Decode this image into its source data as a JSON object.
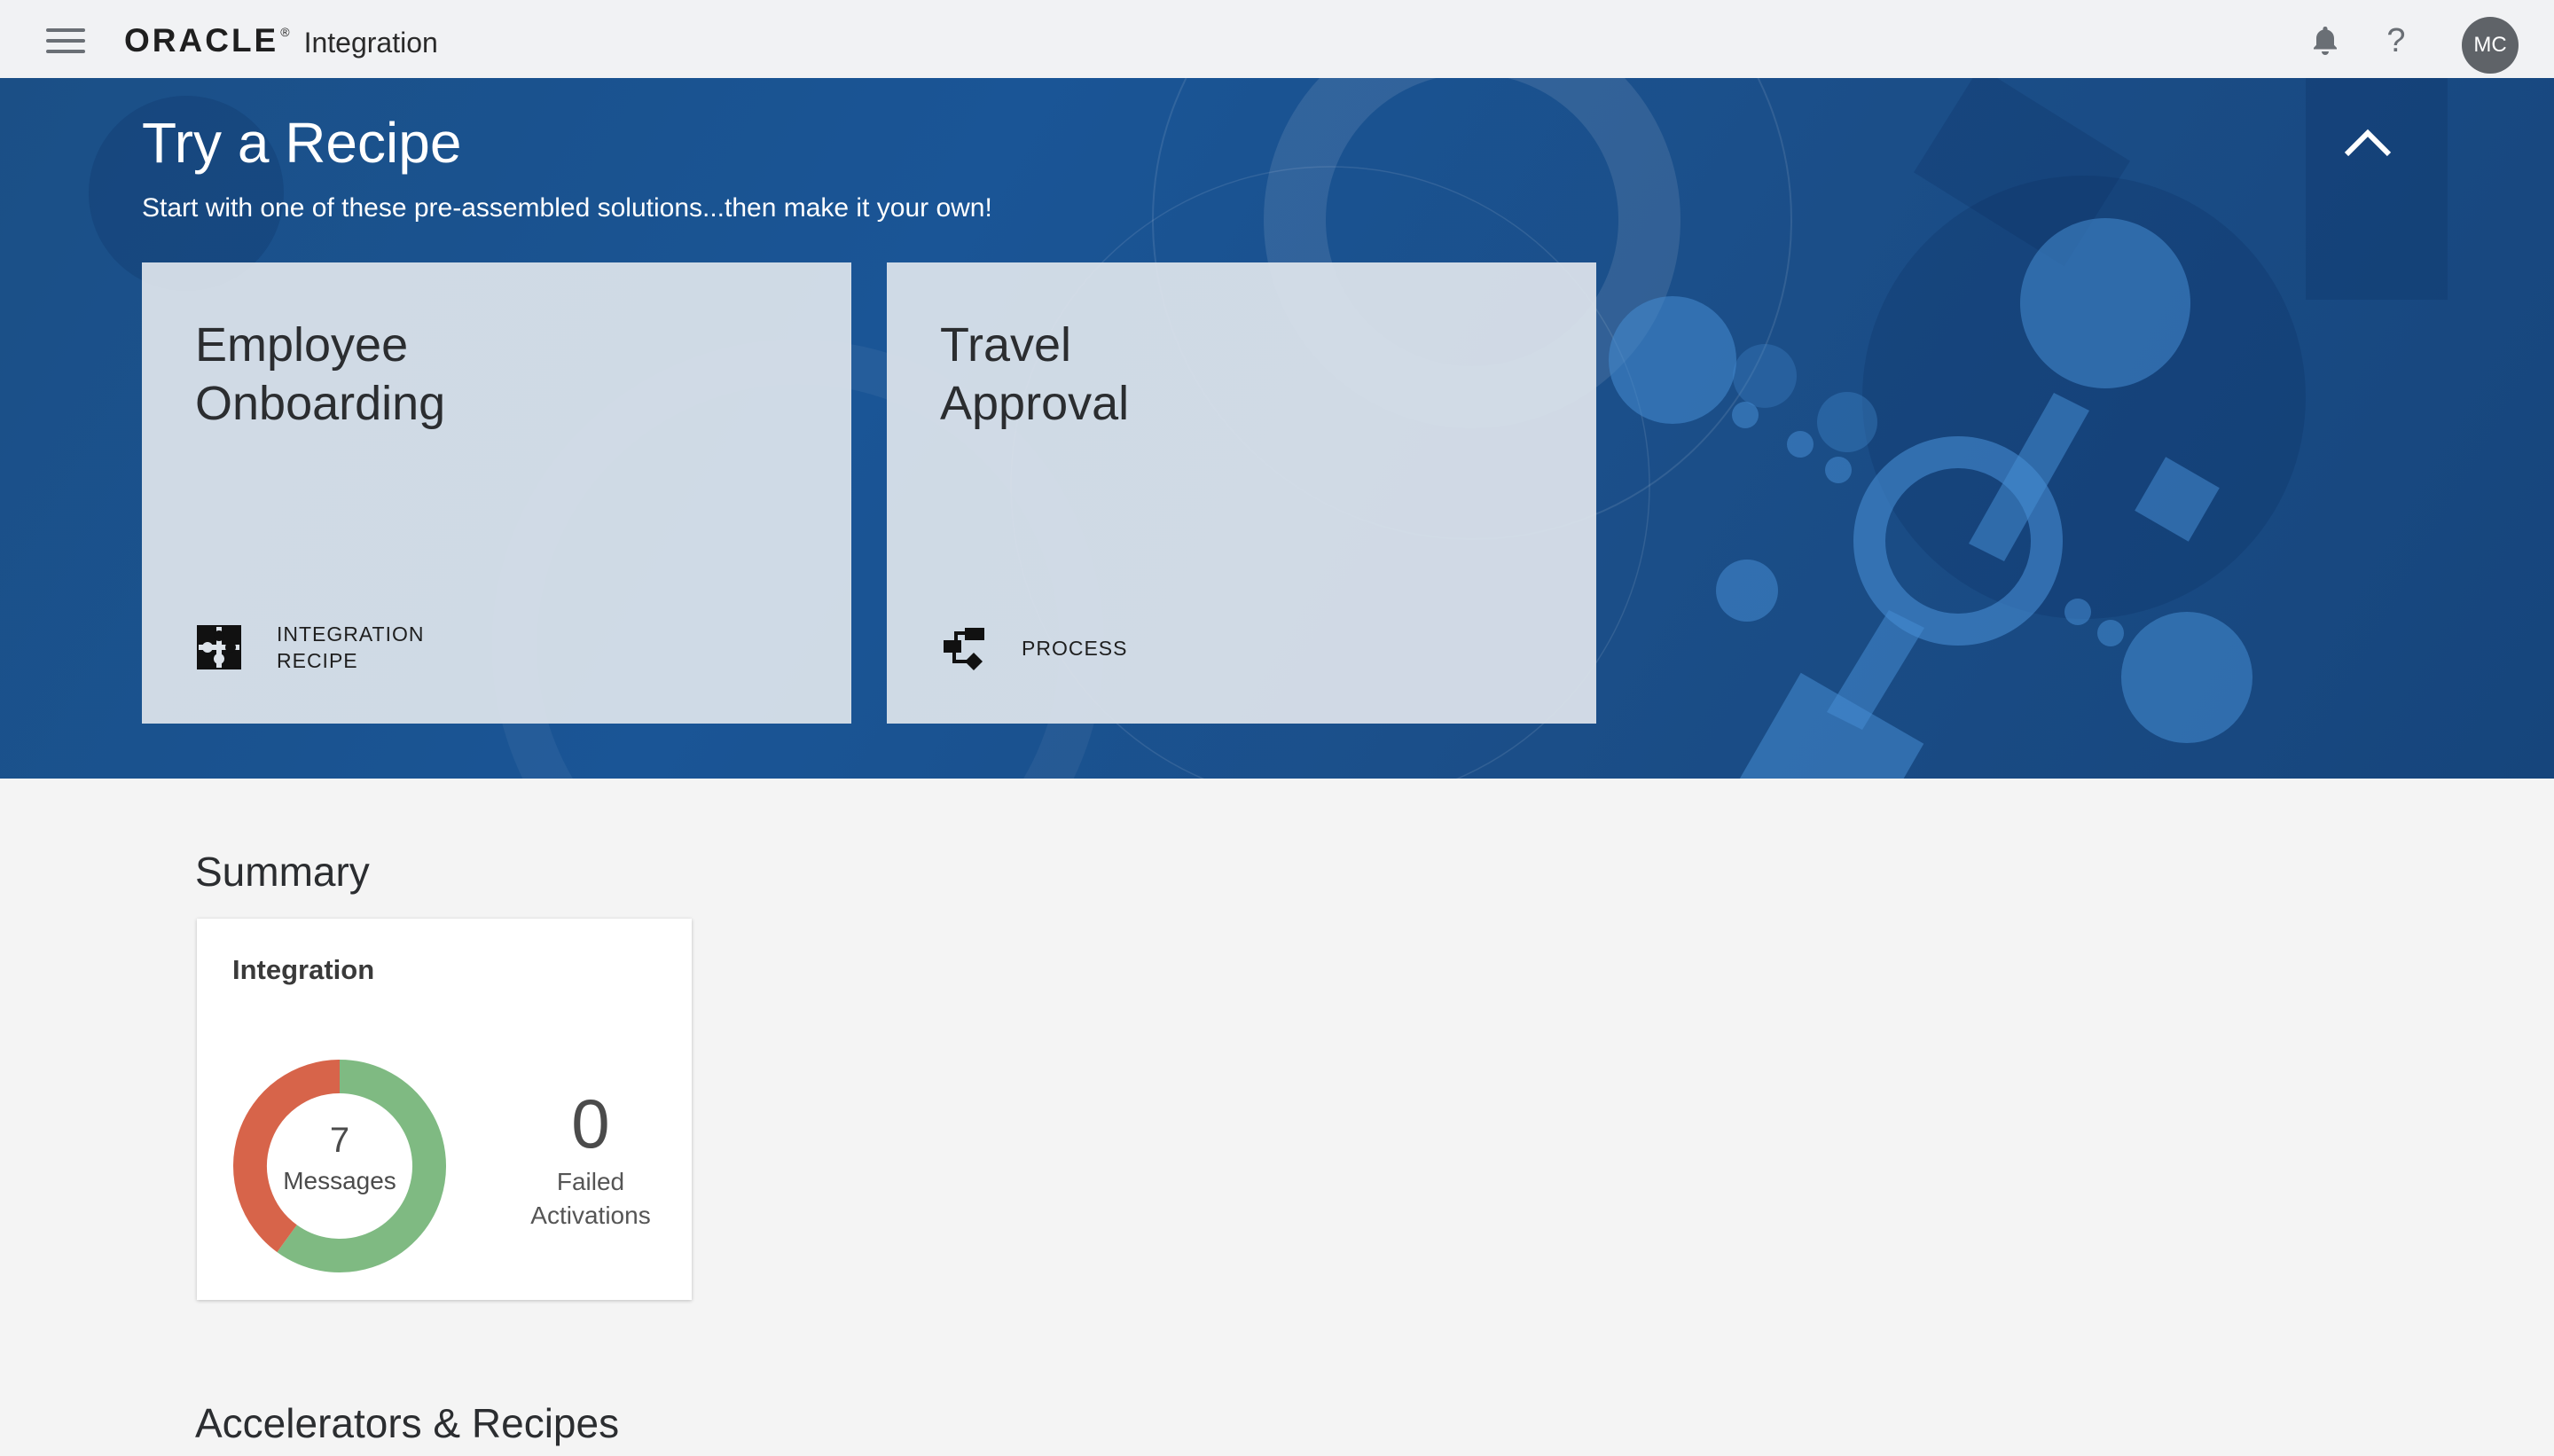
{
  "header": {
    "logo_word": "ORACLE",
    "logo_reg": "®",
    "product": "Integration",
    "help_label": "?",
    "avatar_initials": "MC"
  },
  "banner": {
    "title": "Try a Recipe",
    "subtitle": "Start with one of these pre-assembled solutions...then make it your own!",
    "cards": [
      {
        "name_line1": "Employee",
        "name_line2": "Onboarding",
        "type_line1": "INTEGRATION",
        "type_line2": "RECIPE",
        "icon": "puzzle-icon"
      },
      {
        "name_line1": "Travel",
        "name_line2": "Approval",
        "type_line1": "PROCESS",
        "type_line2": "",
        "icon": "process-flow-icon"
      }
    ]
  },
  "summary": {
    "title": "Summary",
    "card": {
      "title": "Integration",
      "messages_count": "7",
      "messages_label": "Messages",
      "failed_count": "0",
      "failed_label_line1": "Failed",
      "failed_label_line2": "Activations"
    },
    "donut_segments": [
      {
        "name": "success",
        "fraction": 0.6,
        "color": "#7fba82"
      },
      {
        "name": "error",
        "fraction": 0.4,
        "color": "#d7644a"
      }
    ]
  },
  "accelerators": {
    "title": "Accelerators & Recipes"
  }
}
